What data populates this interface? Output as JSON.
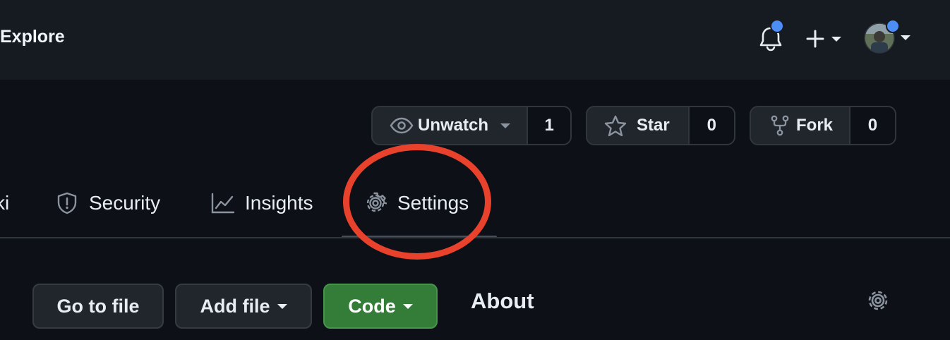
{
  "header": {
    "explore_label": "Explore",
    "icons": [
      "bell-icon",
      "plus-icon",
      "avatar"
    ],
    "notification_dot_color": "#4c8df6"
  },
  "repo_actions": {
    "watch": {
      "label": "Unwatch",
      "count": "1",
      "icon": "eye-icon"
    },
    "star": {
      "label": "Star",
      "count": "0",
      "icon": "star-icon"
    },
    "fork": {
      "label": "Fork",
      "count": "0",
      "icon": "repo-forked-icon"
    }
  },
  "tabs": [
    {
      "label": "ki",
      "icon": "book-icon"
    },
    {
      "label": "Security",
      "icon": "shield-icon"
    },
    {
      "label": "Insights",
      "icon": "graph-icon"
    },
    {
      "label": "Settings",
      "icon": "gear-icon",
      "selected": true
    }
  ],
  "annotation": {
    "shape": "ellipse",
    "target": "Settings",
    "color": "#e8412c"
  },
  "file_toolbar": {
    "go_to_file": "Go to file",
    "add_file": "Add file",
    "code": "Code",
    "code_color": "#347d39"
  },
  "about": {
    "title": "About",
    "icon": "gear-icon"
  }
}
